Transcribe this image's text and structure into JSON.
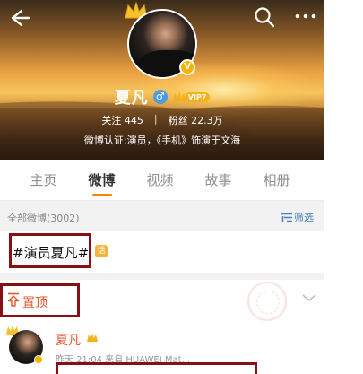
{
  "profile": {
    "name": "夏凡",
    "vip_label": "VIP7",
    "follow_label": "关注",
    "follow_count": "445",
    "fans_label": "粉丝",
    "fans_count": "22.3万",
    "verification": "微博认证:演员，《手机》饰演于文海"
  },
  "tabs": [
    {
      "label": "主页",
      "active": false
    },
    {
      "label": "微博",
      "active": true
    },
    {
      "label": "视频",
      "active": false
    },
    {
      "label": "故事",
      "active": false
    },
    {
      "label": "相册",
      "active": false
    }
  ],
  "filter": {
    "count_label": "全部微博(3002)",
    "filter_label": "筛选"
  },
  "topic": {
    "text": "#演员夏凡#"
  },
  "post": {
    "pinned_label": "置顶",
    "author": "夏凡",
    "meta": "昨天 21:04  来自 HUAWEI Mat..."
  },
  "colors": {
    "accent": "#ff8200",
    "highlight_box": "#8a0f14",
    "link_blue": "#4a7fbf",
    "name_orange": "#e5562b"
  },
  "icons": [
    "back-arrow-icon",
    "search-icon",
    "more-icon",
    "crown-icon",
    "verified-icon",
    "gender-male-icon",
    "vip-icon",
    "filter-icon",
    "pin-icon",
    "chevron-down-icon"
  ]
}
